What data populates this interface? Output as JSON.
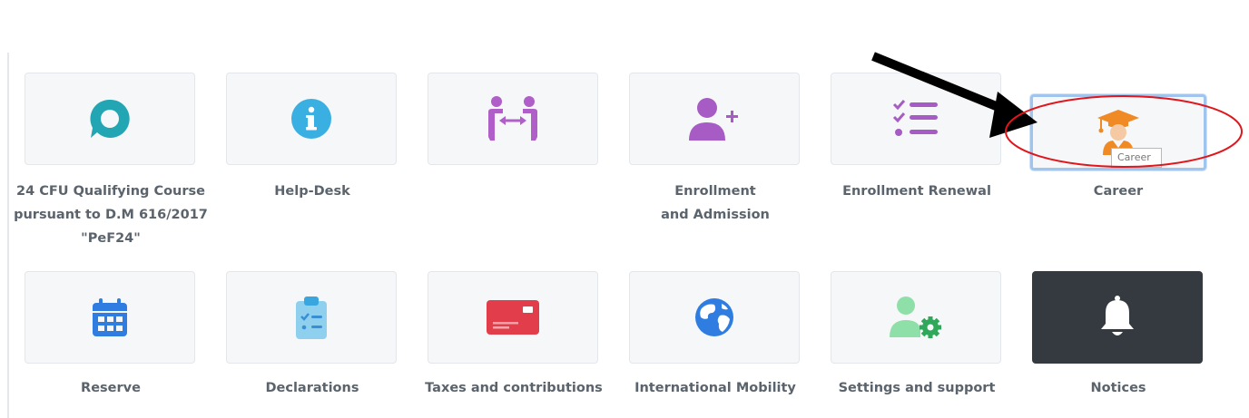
{
  "tiles": [
    {
      "label": "24 CFU Qualifying Course pursuant to D.M 616/2017 \"PeF24\"",
      "icon": "chat-bubble-icon",
      "color": "#22a6b3"
    },
    {
      "label": "Help-Desk",
      "icon": "info-icon",
      "color": "#3ab0e2"
    },
    {
      "label": "",
      "icon": "exchange-people-icon",
      "color": "#b05fc9"
    },
    {
      "label": "Enrollment and Admission",
      "icon": "add-user-icon",
      "color": "#a65cc4"
    },
    {
      "label": "Enrollment Renewal",
      "icon": "checklist-icon",
      "color": "#a65cc4"
    },
    {
      "label": "Career",
      "icon": "graduate-icon",
      "color": "#f08a24"
    },
    {
      "label": "Reserve",
      "icon": "calendar-icon",
      "color": "#2f7de1"
    },
    {
      "label": "Declarations",
      "icon": "clipboard-icon",
      "color": "#62b8e6"
    },
    {
      "label": "Taxes and contributions",
      "icon": "payment-card-icon",
      "color": "#e23d4b"
    },
    {
      "label": "International Mobility",
      "icon": "globe-icon",
      "color": "#2f7de1"
    },
    {
      "label": "Settings and support",
      "icon": "user-settings-icon",
      "color": "#3fbf6e"
    },
    {
      "label": "Notices",
      "icon": "bell-icon",
      "color": "#ffffff"
    }
  ],
  "tooltip": {
    "text": "Career"
  },
  "annotation": {
    "arrow_color": "#000000",
    "circle_color": "#e0161c"
  }
}
